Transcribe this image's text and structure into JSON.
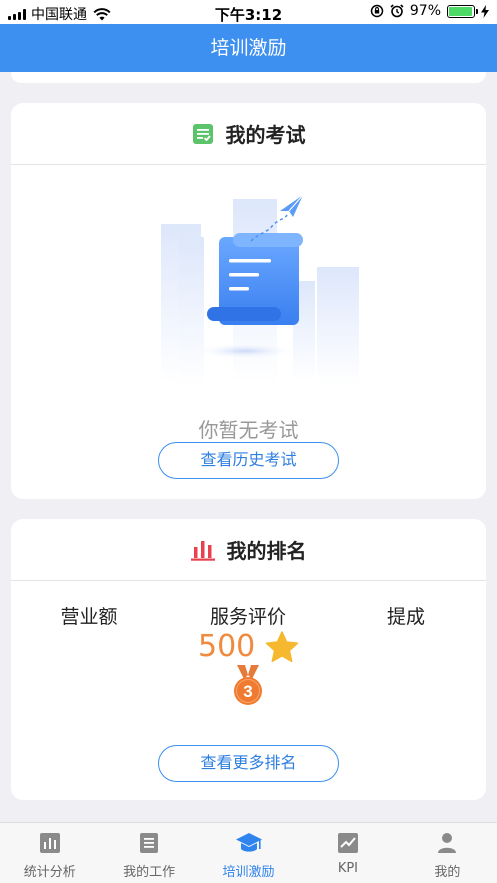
{
  "status_bar": {
    "carrier": "中国联通",
    "time": "下午3:12",
    "battery": "97%",
    "battery_level": 0.97
  },
  "nav": {
    "title": "培训激励"
  },
  "exam_card": {
    "title": "我的考试",
    "empty_text": "你暂无考试",
    "history_button": "查看历史考试"
  },
  "rank_card": {
    "title": "我的排名",
    "columns": [
      "营业额",
      "服务评价",
      "提成"
    ],
    "service_score": "500",
    "medal_rank": "3",
    "more_button": "查看更多排名"
  },
  "tabs": [
    {
      "label": "统计分析",
      "icon": "bar-chart-icon",
      "active": false
    },
    {
      "label": "我的工作",
      "icon": "document-icon",
      "active": false
    },
    {
      "label": "培训激励",
      "icon": "graduation-cap-icon",
      "active": true
    },
    {
      "label": "KPI",
      "icon": "line-chart-icon",
      "active": false
    },
    {
      "label": "我的",
      "icon": "user-icon",
      "active": false
    }
  ],
  "colors": {
    "primary": "#3d8ff0",
    "tab_active": "#2f84ee",
    "score": "#f08a3e",
    "rank_icon": "#e8414d",
    "exam_icon": "#5bc46a"
  }
}
